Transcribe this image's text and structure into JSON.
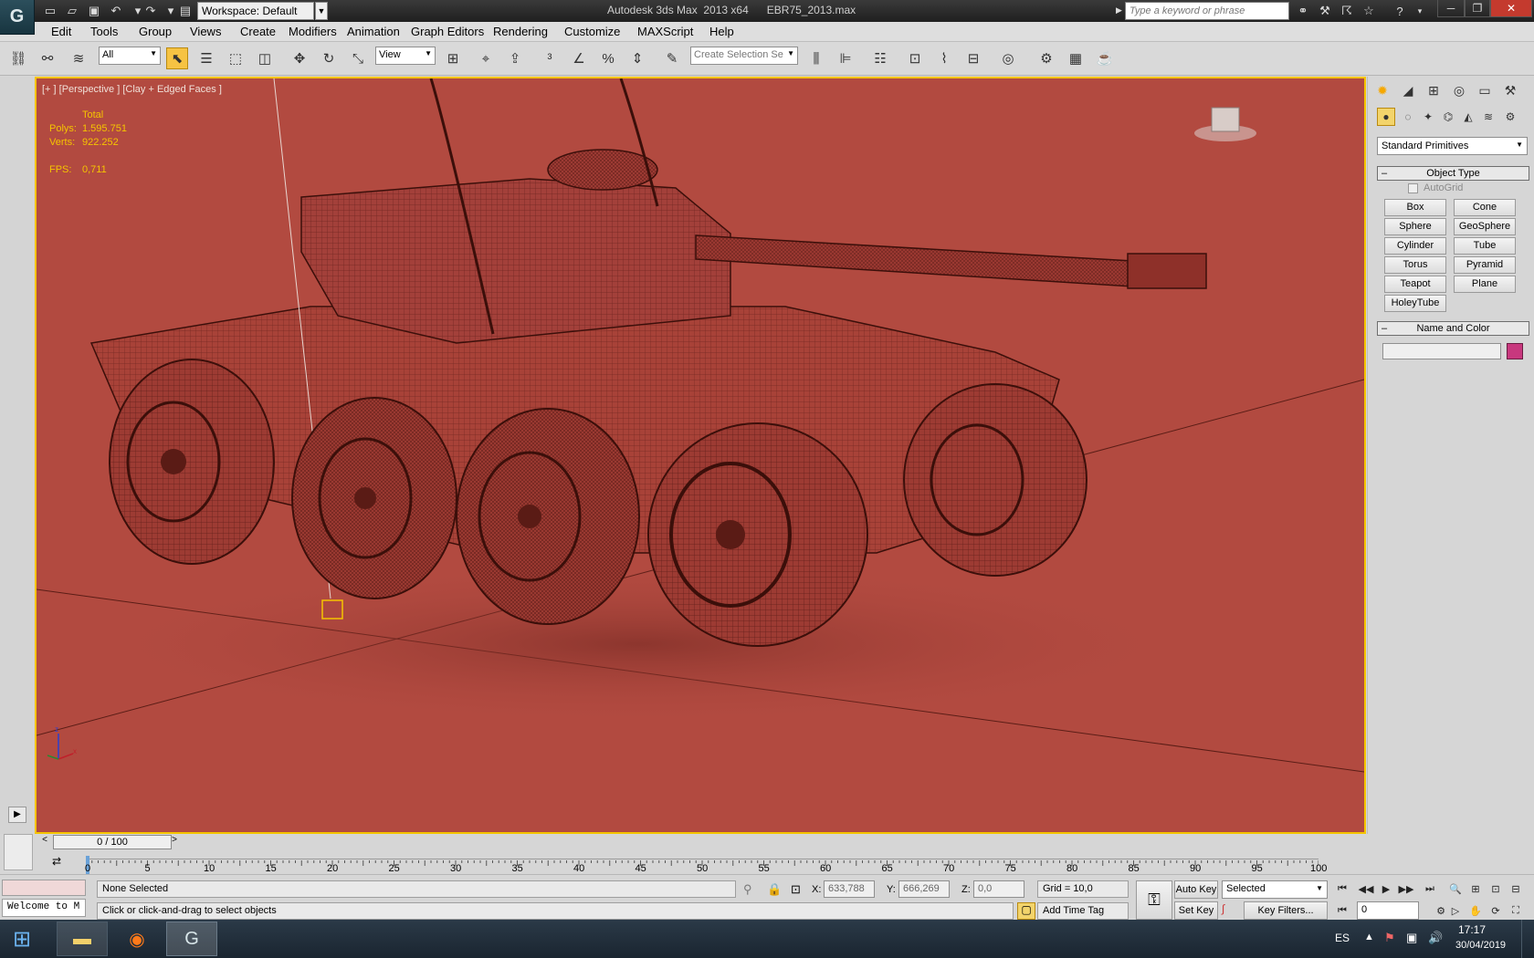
{
  "titlebar": {
    "workspace": "Workspace: Default",
    "title": "Autodesk 3ds Max  2013 x64      EBR75_2013.max",
    "search_placeholder": "Type a keyword or phrase"
  },
  "menu": [
    "Edit",
    "Tools",
    "Group",
    "Views",
    "Create",
    "Modifiers",
    "Animation",
    "Graph Editors",
    "Rendering",
    "Customize",
    "MAXScript",
    "Help"
  ],
  "toolbar": {
    "filter_value": "All",
    "ref_coord": "View",
    "selection_set_placeholder": "Create Selection Se"
  },
  "viewport": {
    "label": "[+ ] [Perspective ] [Clay + Edged Faces ]",
    "stats": {
      "total_label": "Total",
      "polys_label": "Polys:",
      "polys_value": "1.595.751",
      "verts_label": "Verts:",
      "verts_value": "922.252",
      "fps_label": "FPS:",
      "fps_value": "0,711"
    },
    "background_color": "#b24a40"
  },
  "command_panel": {
    "dropdown": "Standard Primitives",
    "object_type_title": "Object Type",
    "autogrid": "AutoGrid",
    "buttons": [
      "Box",
      "Cone",
      "Sphere",
      "GeoSphere",
      "Cylinder",
      "Tube",
      "Torus",
      "Pyramid",
      "Teapot",
      "Plane",
      "HoleyTube"
    ],
    "name_color_title": "Name and Color",
    "swatch_color": "#c8387e"
  },
  "timeline": {
    "slider_text": "0 / 100",
    "ticks": [
      "0",
      "5",
      "10",
      "15",
      "20",
      "25",
      "30",
      "35",
      "40",
      "45",
      "50",
      "55",
      "60",
      "65",
      "70",
      "75",
      "80",
      "85",
      "90",
      "95",
      "100"
    ]
  },
  "status": {
    "maxscript_text": "Welcome to M",
    "selection_status": "None Selected",
    "prompt": "Click or click-and-drag to select objects",
    "x_label": "X:",
    "x_value": "633,788",
    "y_label": "Y:",
    "y_value": "666,269",
    "z_label": "Z:",
    "z_value": "0,0",
    "grid": "Grid = 10,0",
    "add_time_tag": "Add Time Tag",
    "auto_key": "Auto Key",
    "set_key": "Set Key",
    "selected_dd": "Selected",
    "key_filters": "Key Filters...",
    "frame_value": "0"
  },
  "taskbar": {
    "lang": "ES",
    "time": "17:17",
    "date": "30/04/2019"
  }
}
